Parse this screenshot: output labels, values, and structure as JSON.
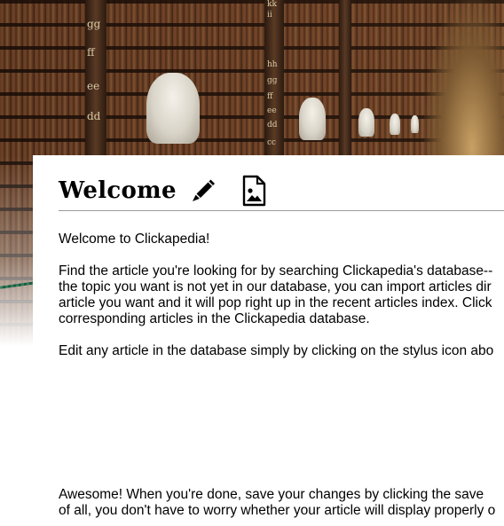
{
  "header": {
    "background_image": "library-long-room",
    "shelf_letters": [
      "gg",
      "ff",
      "ee",
      "dd",
      "kk",
      "ii",
      "hh",
      "gg",
      "ff",
      "ee",
      "dd",
      "cc"
    ]
  },
  "article": {
    "title": "Welcome",
    "edit_icon": "pencil-icon",
    "image_icon": "image-file-icon",
    "paragraphs": [
      "Welcome to Clickapedia!",
      "Find the article you're looking for by searching Clickapedia's database--",
      "the topic you want is not yet in our database, you can import articles dir",
      "article you want and it will pop right up in the recent articles index. Click",
      "corresponding articles in the Clickapedia database.",
      "Edit any article in the database simply by clicking on the stylus icon abo",
      "Awesome!  When you're done, save your changes by clicking the save",
      "of all, you don't have to worry whether your article will display properly o"
    ]
  },
  "colors": {
    "divider": "#9a9a9a",
    "text": "#000000",
    "background": "#ffffff"
  }
}
